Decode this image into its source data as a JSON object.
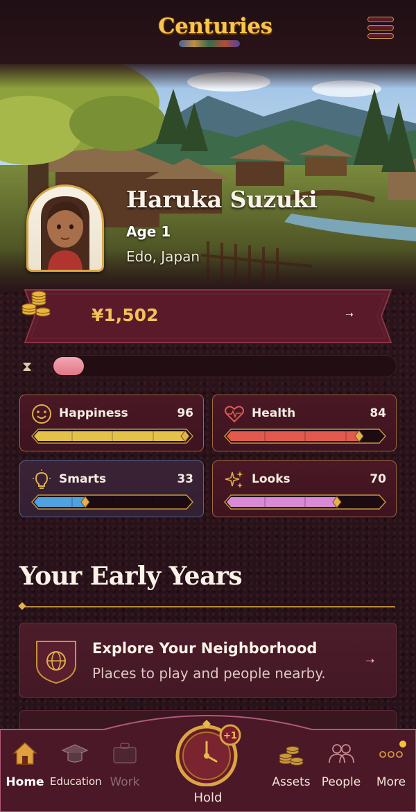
{
  "header": {
    "logo_text": "Centuries",
    "menu_icon": "hamburger-menu-icon"
  },
  "character": {
    "name": "Haruka Suzuki",
    "age": "Age 1",
    "location": "Edo, Japan"
  },
  "money": {
    "amount": "¥1,502",
    "icon": "gold-coins-icon"
  },
  "age_progress": {
    "icon": "hourglass-icon",
    "fraction": 0.09
  },
  "stats": [
    {
      "label": "Happiness",
      "value": "96",
      "fraction": 0.96,
      "color": "#e4c24a",
      "icon": "smiley-face-icon"
    },
    {
      "label": "Health",
      "value": "84",
      "fraction": 0.84,
      "color": "#e25a4e",
      "icon": "heartbeat-icon"
    },
    {
      "label": "Smarts",
      "value": "33",
      "fraction": 0.33,
      "color": "#4ea2e0",
      "icon": "lightbulb-icon"
    },
    {
      "label": "Looks",
      "value": "70",
      "fraction": 0.7,
      "color": "#d98ad6",
      "icon": "sparkles-icon"
    }
  ],
  "section": {
    "title": "Your Early Years"
  },
  "activities": [
    {
      "title": "Explore Your Neighborhood",
      "subtitle": "Places to play and people nearby.",
      "icon": "globe-shield-icon"
    }
  ],
  "bottom_nav": {
    "items": [
      {
        "label": "Home",
        "icon": "home-icon",
        "active": true
      },
      {
        "label": "Education",
        "icon": "graduation-cap-icon",
        "active": false
      },
      {
        "label": "Work",
        "icon": "briefcase-icon",
        "active": false,
        "disabled": true
      },
      {
        "label": "Assets",
        "icon": "coin-stack-icon",
        "active": false
      },
      {
        "label": "People",
        "icon": "people-icon",
        "active": false
      },
      {
        "label": "More",
        "icon": "more-dots-icon",
        "active": false
      }
    ],
    "center": {
      "label": "Hold",
      "icon": "clock-icon",
      "badge_icon": "plus-one-year-icon"
    }
  },
  "colors": {
    "background": "#2a1419",
    "accent_gold": "#d9a646",
    "card": "#4a1824",
    "money_text": "#f2c25a"
  }
}
